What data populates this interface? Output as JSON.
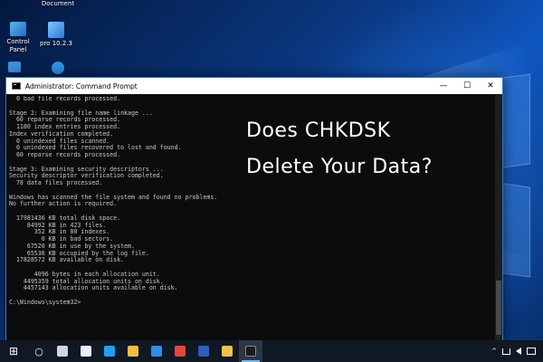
{
  "desktop_icons": [
    {
      "label": "Document"
    },
    {
      "label": "Control\nPanel"
    },
    {
      "label": "pro 10.2.3"
    }
  ],
  "window": {
    "title": "Administrator: Command Prompt",
    "minimize_glyph": "—",
    "maximize_glyph": "☐",
    "close_glyph": "✕"
  },
  "console_lines": [
    "  0 bad file records processed.",
    "",
    "Stage 2: Examining file name linkage ...",
    "  60 reparse records processed.",
    "  1180 index entries processed.",
    "Index verification completed.",
    "  0 unindexed files scanned.",
    "  0 unindexed files recovered to lost and found.",
    "  60 reparse records processed.",
    "",
    "Stage 3: Examining security descriptors ...",
    "Security descriptor verification completed.",
    "  78 data files processed.",
    "",
    "Windows has scanned the file system and found no problems.",
    "No further action is required.",
    "",
    "  17981436 KB total disk space.",
    "     84992 KB in 423 files.",
    "       352 KB in 80 indexes.",
    "         0 KB in bad sectors.",
    "     67520 KB in use by the system.",
    "     65536 KB occupied by the log file.",
    "  17828572 KB available on disk.",
    "",
    "       4096 bytes in each allocation unit.",
    "    4495359 total allocation units on disk.",
    "    4457143 allocation units available on disk.",
    "",
    "C:\\Windows\\system32>"
  ],
  "headline": {
    "line1": "Does CHKDSK",
    "line2": "Delete Your Data?"
  },
  "taskbar": {
    "start_glyph": "⊞",
    "search_glyph": "○",
    "tray_up_glyph": "^",
    "items": [
      {
        "name": "task-view-icon",
        "color": "#cfd6e0"
      },
      {
        "name": "paint-icon",
        "color": "#e8eef8"
      },
      {
        "name": "qq-icon",
        "color": "#1ea1f1"
      },
      {
        "name": "file-explorer-icon",
        "color": "#f0c040"
      },
      {
        "name": "app-icon",
        "color": "#2e8ee6"
      },
      {
        "name": "chrome-icon",
        "color": "#e04a3c"
      },
      {
        "name": "word-icon",
        "color": "#2b5fb8"
      },
      {
        "name": "folder-icon",
        "color": "#f2c14e"
      },
      {
        "name": "command-prompt-icon",
        "color": "#1a1a1a"
      }
    ]
  }
}
